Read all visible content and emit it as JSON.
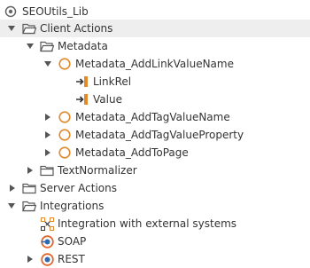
{
  "tree": {
    "root_label": "SEOUtils_Lib",
    "client_actions_label": "Client Actions",
    "metadata_label": "Metadata",
    "add_link_value_name_label": "Metadata_AddLinkValueName",
    "link_rel_label": "LinkRel",
    "value_label": "Value",
    "add_tag_value_name_label": "Metadata_AddTagValueName",
    "add_tag_value_property_label": "Metadata_AddTagValueProperty",
    "add_to_page_label": "Metadata_AddToPage",
    "text_normalizer_label": "TextNormalizer",
    "server_actions_label": "Server Actions",
    "integrations_label": "Integrations",
    "integration_external_label": "Integration with external systems",
    "soap_label": "SOAP",
    "rest_label": "REST"
  },
  "colors": {
    "text": "#333333",
    "selected_row": "#eeeeee",
    "folder": "#5a5a5a",
    "action_circle": "#e08a2c",
    "input_param": "#e08a2c",
    "soap_icon": "#e0662c"
  }
}
